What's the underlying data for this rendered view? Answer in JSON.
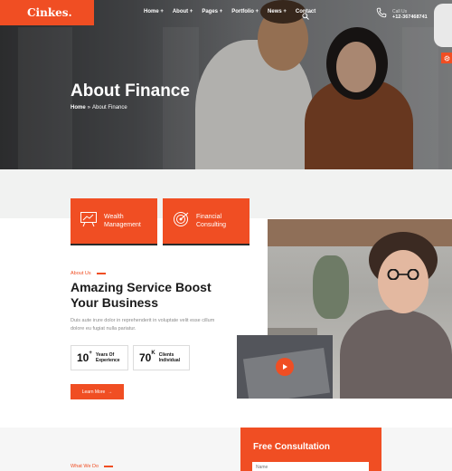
{
  "brand": {
    "logo": "Cinkes.",
    "accent": "#f04e23"
  },
  "nav": {
    "items": [
      "Home +",
      "About +",
      "Pages +",
      "Portfolio +",
      "News +",
      "Contact"
    ],
    "search_icon": "search-icon"
  },
  "call": {
    "label": "Call Us",
    "number": "+12-367468741",
    "icon": "phone-icon"
  },
  "hero": {
    "title": "About Finance",
    "breadcrumb_home": "Home",
    "breadcrumb_sep": "»",
    "breadcrumb_current": "About Finance"
  },
  "services": [
    {
      "label_line1": "Wealth",
      "label_line2": "Management",
      "icon": "chart-board-icon"
    },
    {
      "label_line1": "Financial",
      "label_line2": "Consulting",
      "icon": "target-icon"
    }
  ],
  "about": {
    "eyebrow": "About Us",
    "title_line1": "Amazing Service Boost",
    "title_line2": "Your Business",
    "description": "Duis aute irure dolor in reprehenderit in voluptate velit esse cillum dolore eu fugiat nulla pariatur.",
    "stats": [
      {
        "value": "10",
        "suffix": "+",
        "label_line1": "Years Of",
        "label_line2": "Experience"
      },
      {
        "value": "70",
        "suffix": "K",
        "label_line1": "Clients",
        "label_line2": "Individual"
      }
    ],
    "button": "Learn More",
    "button_arrow": "→"
  },
  "what_we_do": {
    "eyebrow": "What We Do"
  },
  "consultation": {
    "title": "Free Consultation",
    "name_placeholder": "Name"
  }
}
